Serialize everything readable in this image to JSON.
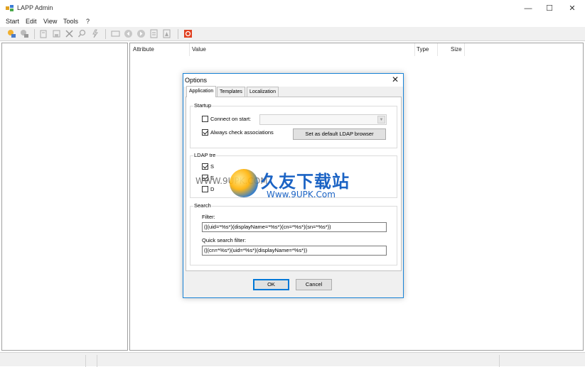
{
  "window": {
    "title": "LAPP Admin",
    "minimize": "—",
    "maximize": "☐",
    "close": "✕"
  },
  "menu": [
    "Start",
    "Edit",
    "View",
    "Tools",
    "?"
  ],
  "list_columns": [
    "Attribute",
    "Value",
    "Type",
    "Size"
  ],
  "dialog": {
    "title": "Options",
    "close": "✕",
    "tabs": [
      "Application",
      "Templates",
      "Localization"
    ],
    "active_tab": "Application",
    "startup": {
      "group_title": "Startup",
      "connect_on_start": {
        "label": "Connect on start:",
        "checked": false
      },
      "always_check_associations": {
        "label": "Always check associations",
        "checked": true
      },
      "set_default_button": "Set as default LDAP browser"
    },
    "ldap_tree": {
      "group_title": "LDAP tre",
      "option1": {
        "label": "S",
        "checked": true
      },
      "option2": {
        "label": "E",
        "checked": true
      },
      "option3": {
        "label": "D",
        "checked": false
      }
    },
    "search": {
      "group_title": "Search",
      "filter_label": "Filter:",
      "filter_value": "(|(uid=*%s*)(displayName=*%s*)(cn=*%s*)(sn=*%s*))",
      "quick_filter_label": "Quick search filter:",
      "quick_filter_value": "(|(cn=*%s*)(uid=*%s*)(displayName=*%s*))"
    },
    "ok": "OK",
    "cancel": "Cancel"
  },
  "watermark": {
    "cn": "久友下载站",
    "url": "Www.9UPK.Com",
    "left": "WWW.9UPK.COM"
  },
  "colors": {
    "accent": "#0078d7",
    "dialog_border": "#1883d7",
    "watermark": "#1b63c4"
  }
}
